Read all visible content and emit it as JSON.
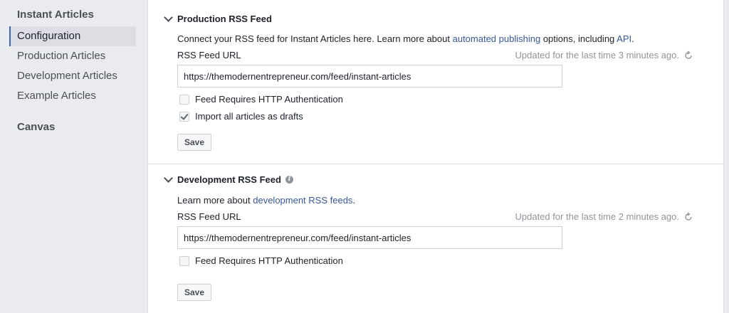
{
  "sidebar": {
    "heading": "Instant Articles",
    "items": [
      {
        "label": "Configuration"
      },
      {
        "label": "Production Articles"
      },
      {
        "label": "Development Articles"
      },
      {
        "label": "Example Articles"
      }
    ],
    "heading2": "Canvas"
  },
  "production": {
    "title": "Production RSS Feed",
    "desc_pre": "Connect your RSS feed for Instant Articles here. Learn more about ",
    "desc_link1": "automated publishing",
    "desc_mid": " options, including ",
    "desc_link2": "API",
    "desc_post": ".",
    "field_label": "RSS Feed URL",
    "updated": "Updated for the last time 3 minutes ago.",
    "url_value": "https://themodernentrepreneur.com/feed/instant-articles",
    "auth_label": "Feed Requires HTTP Authentication",
    "auth_checked": false,
    "drafts_label": "Import all articles as drafts",
    "drafts_checked": true,
    "save_label": "Save"
  },
  "development": {
    "title": "Development RSS Feed",
    "desc_pre": "Learn more about ",
    "desc_link": "development RSS feeds",
    "desc_post": ".",
    "field_label": "RSS Feed URL",
    "updated": "Updated for the last time 2 minutes ago.",
    "url_value": "https://themodernentrepreneur.com/feed/instant-articles",
    "auth_label": "Feed Requires HTTP Authentication",
    "auth_checked": false,
    "save_label": "Save"
  },
  "colors": {
    "link": "#365899",
    "accent": "#4267b2",
    "muted": "#90949c"
  }
}
